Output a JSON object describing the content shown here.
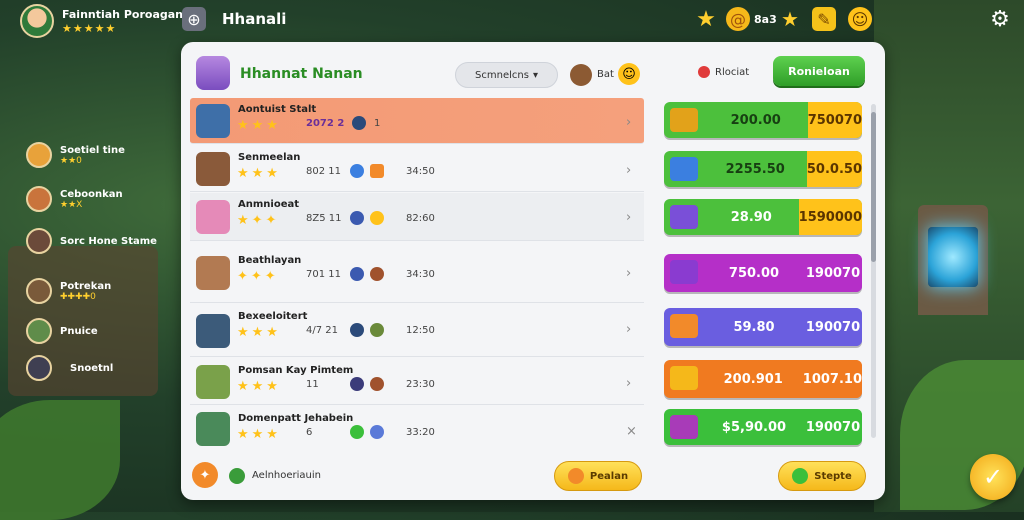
{
  "top": {
    "player_name": "Fainntiah Poroagan",
    "player_stars": "★★★★★",
    "title": "Hhanali",
    "count": "8a3"
  },
  "side": [
    {
      "name": "Soetiel tine",
      "sub": "★★0",
      "color": "#e8a23a"
    },
    {
      "name": "Ceboonkan",
      "sub": "★★X",
      "color": "#c9743c"
    },
    {
      "name": "Sorc Hone Stame",
      "sub": "",
      "color": "#6b4a3a"
    },
    {
      "name": "Potrekan",
      "sub": "✚✚✚✚0",
      "color": "#7a5a3a"
    },
    {
      "name": "Pnuice",
      "sub": "",
      "color": "#5f8c4a"
    },
    {
      "name": "Snoetnl",
      "sub": "",
      "color": "#3f3f52"
    }
  ],
  "panel": {
    "title": "Hhannat Nanan",
    "sort_label": "Scmnelcns",
    "badge_text": "Bat",
    "reward_label": "Rlociat",
    "claim_label": "Ronieloan"
  },
  "rows": [
    {
      "name": "Aontuist Stalt",
      "stars": "★★★",
      "score": "2072 2",
      "time": "1",
      "avatar": "#3e6fa8"
    },
    {
      "name": "Senmeelan",
      "stars": "★★★",
      "score": "802 11",
      "time": "34:50",
      "avatar": "#8a5a3a"
    },
    {
      "name": "Anmnioeat",
      "stars": "★✦✦",
      "score": "8Z5 11",
      "time": "82:60",
      "avatar": "#e58ab8"
    },
    {
      "name": "Beathlayan",
      "stars": "✦✦✦",
      "score": "701 11",
      "time": "34:30",
      "avatar": "#b27a52"
    },
    {
      "name": "Bexeeloitert",
      "stars": "★★★",
      "score": "4/7 21",
      "time": "12:50",
      "avatar": "#3c5b7a"
    },
    {
      "name": "Pomsan Kay Pimtem",
      "stars": "★★★",
      "score": "11",
      "time": "23:30",
      "avatar": "#7aa14a"
    },
    {
      "name": "Domenpatt Jehabein",
      "stars": "★★★",
      "score": "6",
      "time": "33:20",
      "avatar": "#4a8a5a"
    }
  ],
  "rewards": [
    {
      "a": "200.00",
      "b": "750070",
      "ca": "#4cc03c",
      "cb": "#ffc21a",
      "icon": "#e2a21a",
      "ta": "#173f12",
      "tb": "#5a3500",
      "split": 105
    },
    {
      "a": "2255.50",
      "b": "50.0.50",
      "ca": "#4cc03c",
      "cb": "#ffc21a",
      "icon": "#3b7fe0",
      "ta": "#173f12",
      "tb": "#5a3500",
      "split": 105
    },
    {
      "a": "28.90",
      "b": "1590000",
      "ca": "#4cc03c",
      "cb": "#ffc21a",
      "icon": "#7a4fd8",
      "ta": "#ffffff",
      "tb": "#5a3500",
      "split": 95
    },
    {
      "a": "750.00",
      "b": "190070",
      "ca": "#b52fc8",
      "cb": "#b52fc8",
      "icon": "#8a3bd0",
      "ta": "#ffffff",
      "tb": "#ffffff",
      "split": 100
    },
    {
      "a": "59.80",
      "b": "190070",
      "ca": "#6a5ee0",
      "cb": "#6a5ee0",
      "icon": "#f28a2a",
      "ta": "#ffffff",
      "tb": "#ffffff",
      "split": 100
    },
    {
      "a": "200.901",
      "b": "1007.10",
      "ca": "#f07a20",
      "cb": "#f07a20",
      "icon": "#f5b81a",
      "ta": "#ffffff",
      "tb": "#ffffff",
      "split": 100
    },
    {
      "a": "$5,90.00",
      "b": "190070",
      "ca": "#3bbf3b",
      "cb": "#3bbf3b",
      "icon": "#a83bb8",
      "ta": "#ffffff",
      "tb": "#ffffff",
      "split": 100
    }
  ],
  "footer": {
    "label": "Aelnhoeriauin",
    "btn1": "Pealan",
    "btn2": "Stepte"
  }
}
